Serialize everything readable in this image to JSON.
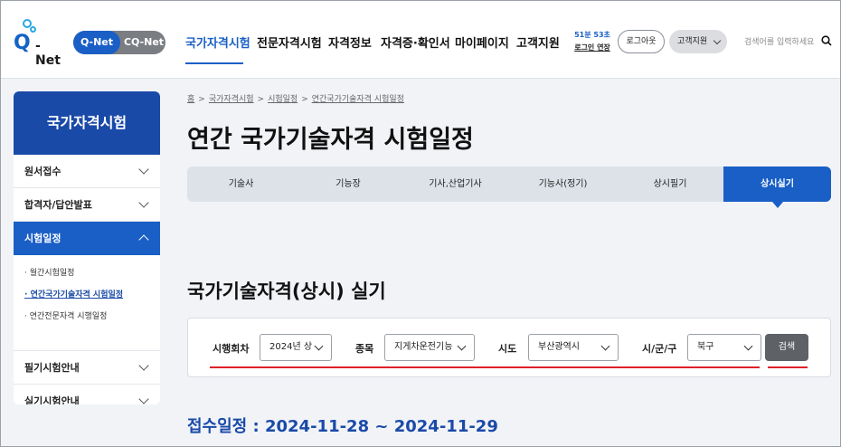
{
  "header": {
    "logo_text": "Q-Net",
    "toggle": {
      "qnet": "Q-Net",
      "cqnet": "CQ-Net"
    },
    "nav": [
      "국가자격시험",
      "전문자격시험",
      "자격정보",
      "자격증·확인서",
      "마이페이지",
      "고객지원"
    ],
    "active_nav_index": 0,
    "session": {
      "time": "51분 53초",
      "extend": "로그인 연장"
    },
    "logout_label": "로그아웃",
    "support_label": "고객지원",
    "search_placeholder": "검색어를 입력하세요"
  },
  "sidebar": {
    "title": "국가자격시험",
    "items": [
      {
        "label": "원서접수"
      },
      {
        "label": "합격자/답안발표"
      },
      {
        "label": "시험일정"
      },
      {
        "label": "필기시험안내"
      },
      {
        "label": "실기시험안내"
      }
    ],
    "active_index": 2,
    "sub_items": [
      "월간시험일정",
      "연간국가기술자격 시험일정",
      "연간전문자격 시행일정"
    ],
    "active_sub_index": 1
  },
  "breadcrumb": [
    "홈",
    "국가자격시험",
    "시험일정",
    "연간국가기술자격 시험일정"
  ],
  "page_title": "연간 국가기술자격 시험일정",
  "tabs": [
    "기술사",
    "기능장",
    "기사,산업기사",
    "기능사(정기)",
    "상시필기",
    "상시실기"
  ],
  "active_tab_index": 5,
  "section_title": "국가기술자격(상시) 실기",
  "filter": {
    "labels": {
      "round": "시행회차",
      "item": "종목",
      "city": "시도",
      "district": "시/군/구"
    },
    "values": {
      "round": "2024년 상",
      "item": "지게차운전기능",
      "city": "부산광역시",
      "district": "북구"
    },
    "search_label": "검색"
  },
  "dates_text": "접수일정 : 2024-11-28 ~ 2024-11-29",
  "colors": {
    "primary": "#1a5fc6",
    "navy": "#1a4aa8",
    "annotation": "#e0202a"
  }
}
